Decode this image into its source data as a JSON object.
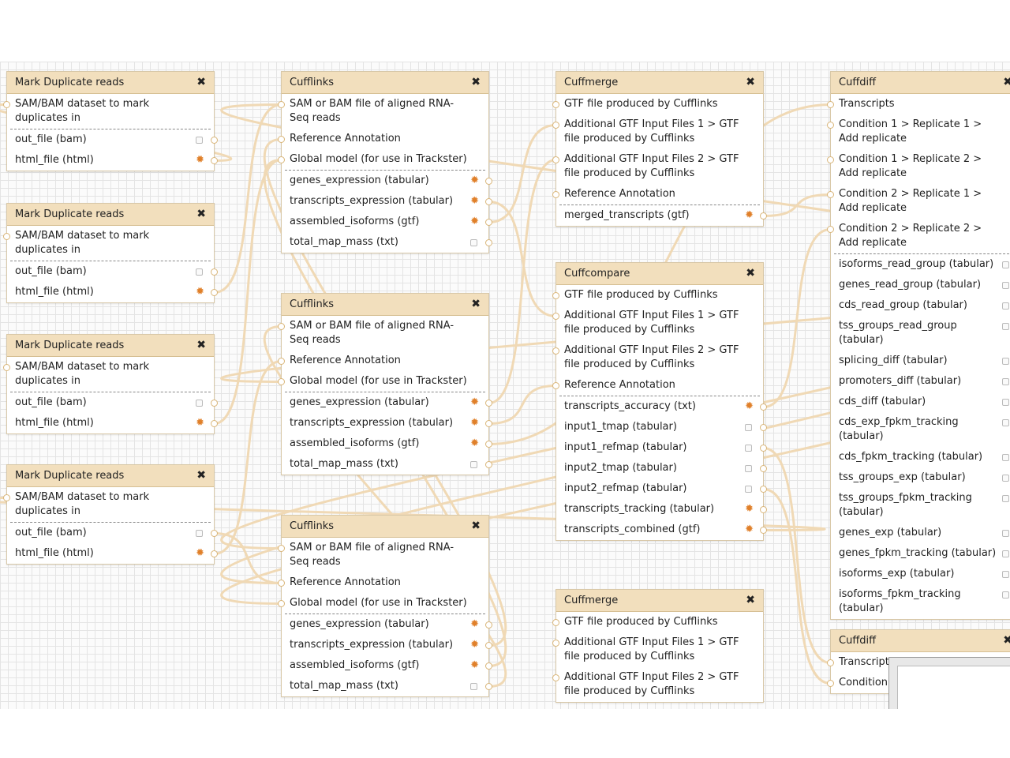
{
  "colors": {
    "header": "#f2dfbd",
    "header_border": "#d6bf93",
    "wire": "#f0d9b5",
    "canvas": "#fbfbfb",
    "grid": "#e4e4e4",
    "star": "#e0802a"
  },
  "icons": {
    "close": "close-icon",
    "terminal": "connector-terminal-icon",
    "checkbox": "workflow-output-unchecked-icon",
    "star": "workflow-output-star-icon"
  },
  "nodes": [
    {
      "title": "Mark Duplicate reads",
      "inputs": [
        "SAM/BAM dataset to mark duplicates in"
      ],
      "outputs": [
        {
          "label": "out_file (bam)",
          "marked": false
        },
        {
          "label": "html_file (html)",
          "marked": true
        }
      ]
    },
    {
      "title": "Mark Duplicate reads",
      "inputs": [
        "SAM/BAM dataset to mark duplicates in"
      ],
      "outputs": [
        {
          "label": "out_file (bam)",
          "marked": false
        },
        {
          "label": "html_file (html)",
          "marked": true
        }
      ]
    },
    {
      "title": "Mark Duplicate reads",
      "inputs": [
        "SAM/BAM dataset to mark duplicates in"
      ],
      "outputs": [
        {
          "label": "out_file (bam)",
          "marked": false
        },
        {
          "label": "html_file (html)",
          "marked": true
        }
      ]
    },
    {
      "title": "Mark Duplicate reads",
      "inputs": [
        "SAM/BAM dataset to mark duplicates in"
      ],
      "outputs": [
        {
          "label": "out_file (bam)",
          "marked": false
        },
        {
          "label": "html_file (html)",
          "marked": true
        }
      ]
    },
    {
      "title": "Cufflinks",
      "inputs": [
        "SAM or BAM file of aligned RNA-Seq reads",
        "Reference Annotation",
        "Global model (for use in Trackster)"
      ],
      "outputs": [
        {
          "label": "genes_expression (tabular)",
          "marked": true
        },
        {
          "label": "transcripts_expression (tabular)",
          "marked": true
        },
        {
          "label": "assembled_isoforms (gtf)",
          "marked": true
        },
        {
          "label": "total_map_mass (txt)",
          "marked": false
        }
      ]
    },
    {
      "title": "Cufflinks",
      "inputs": [
        "SAM or BAM file of aligned RNA-Seq reads",
        "Reference Annotation",
        "Global model (for use in Trackster)"
      ],
      "outputs": [
        {
          "label": "genes_expression (tabular)",
          "marked": true
        },
        {
          "label": "transcripts_expression (tabular)",
          "marked": true
        },
        {
          "label": "assembled_isoforms (gtf)",
          "marked": true
        },
        {
          "label": "total_map_mass (txt)",
          "marked": false
        }
      ]
    },
    {
      "title": "Cufflinks",
      "inputs": [
        "SAM or BAM file of aligned RNA-Seq reads",
        "Reference Annotation",
        "Global model (for use in Trackster)"
      ],
      "outputs": [
        {
          "label": "genes_expression (tabular)",
          "marked": true
        },
        {
          "label": "transcripts_expression (tabular)",
          "marked": true
        },
        {
          "label": "assembled_isoforms (gtf)",
          "marked": true
        },
        {
          "label": "total_map_mass (txt)",
          "marked": false
        }
      ]
    },
    {
      "title": "Cuffmerge",
      "inputs": [
        "GTF file produced by Cufflinks",
        "Additional GTF Input Files 1 > GTF file produced by Cufflinks",
        "Additional GTF Input Files 2 > GTF file produced by Cufflinks",
        "Reference Annotation"
      ],
      "outputs": [
        {
          "label": "merged_transcripts (gtf)",
          "marked": true
        }
      ]
    },
    {
      "title": "Cuffcompare",
      "inputs": [
        "GTF file produced by Cufflinks",
        "Additional GTF Input Files 1 > GTF file produced by Cufflinks",
        "Additional GTF Input Files 2 > GTF file produced by Cufflinks",
        "Reference Annotation"
      ],
      "outputs": [
        {
          "label": "transcripts_accuracy (txt)",
          "marked": true
        },
        {
          "label": "input1_tmap (tabular)",
          "marked": false
        },
        {
          "label": "input1_refmap (tabular)",
          "marked": false
        },
        {
          "label": "input2_tmap (tabular)",
          "marked": false
        },
        {
          "label": "input2_refmap (tabular)",
          "marked": false
        },
        {
          "label": "transcripts_tracking (tabular)",
          "marked": true
        },
        {
          "label": "transcripts_combined (gtf)",
          "marked": true
        }
      ]
    },
    {
      "title": "Cuffmerge",
      "inputs": [
        "GTF file produced by Cufflinks",
        "Additional GTF Input Files 1 > GTF file produced by Cufflinks",
        "Additional GTF Input Files 2 > GTF file produced by Cufflinks"
      ],
      "outputs": []
    },
    {
      "title": "Cuffdiff",
      "inputs": [
        "Transcripts",
        "Condition 1 > Replicate 1 > Add replicate",
        "Condition 1 > Replicate 2 > Add replicate",
        "Condition 2 > Replicate 1 > Add replicate",
        "Condition 2 > Replicate 2 > Add replicate"
      ],
      "outputs": [
        {
          "label": "isoforms_read_group (tabular)",
          "marked": false
        },
        {
          "label": "genes_read_group (tabular)",
          "marked": false
        },
        {
          "label": "cds_read_group (tabular)",
          "marked": false
        },
        {
          "label": "tss_groups_read_group (tabular)",
          "marked": false
        },
        {
          "label": "splicing_diff (tabular)",
          "marked": false
        },
        {
          "label": "promoters_diff (tabular)",
          "marked": false
        },
        {
          "label": "cds_diff (tabular)",
          "marked": false
        },
        {
          "label": "cds_exp_fpkm_tracking (tabular)",
          "marked": false
        },
        {
          "label": "cds_fpkm_tracking (tabular)",
          "marked": false
        },
        {
          "label": "tss_groups_exp (tabular)",
          "marked": false
        },
        {
          "label": "tss_groups_fpkm_tracking (tabular)",
          "marked": false
        },
        {
          "label": "genes_exp (tabular)",
          "marked": false
        },
        {
          "label": "genes_fpkm_tracking (tabular)",
          "marked": false
        },
        {
          "label": "isoforms_exp (tabular)",
          "marked": false
        },
        {
          "label": "isoforms_fpkm_tracking (tabular)",
          "marked": false
        }
      ]
    },
    {
      "title": "Cuffdiff",
      "inputs": [
        "Transcripts",
        "Condition replicate"
      ],
      "outputs": []
    }
  ]
}
